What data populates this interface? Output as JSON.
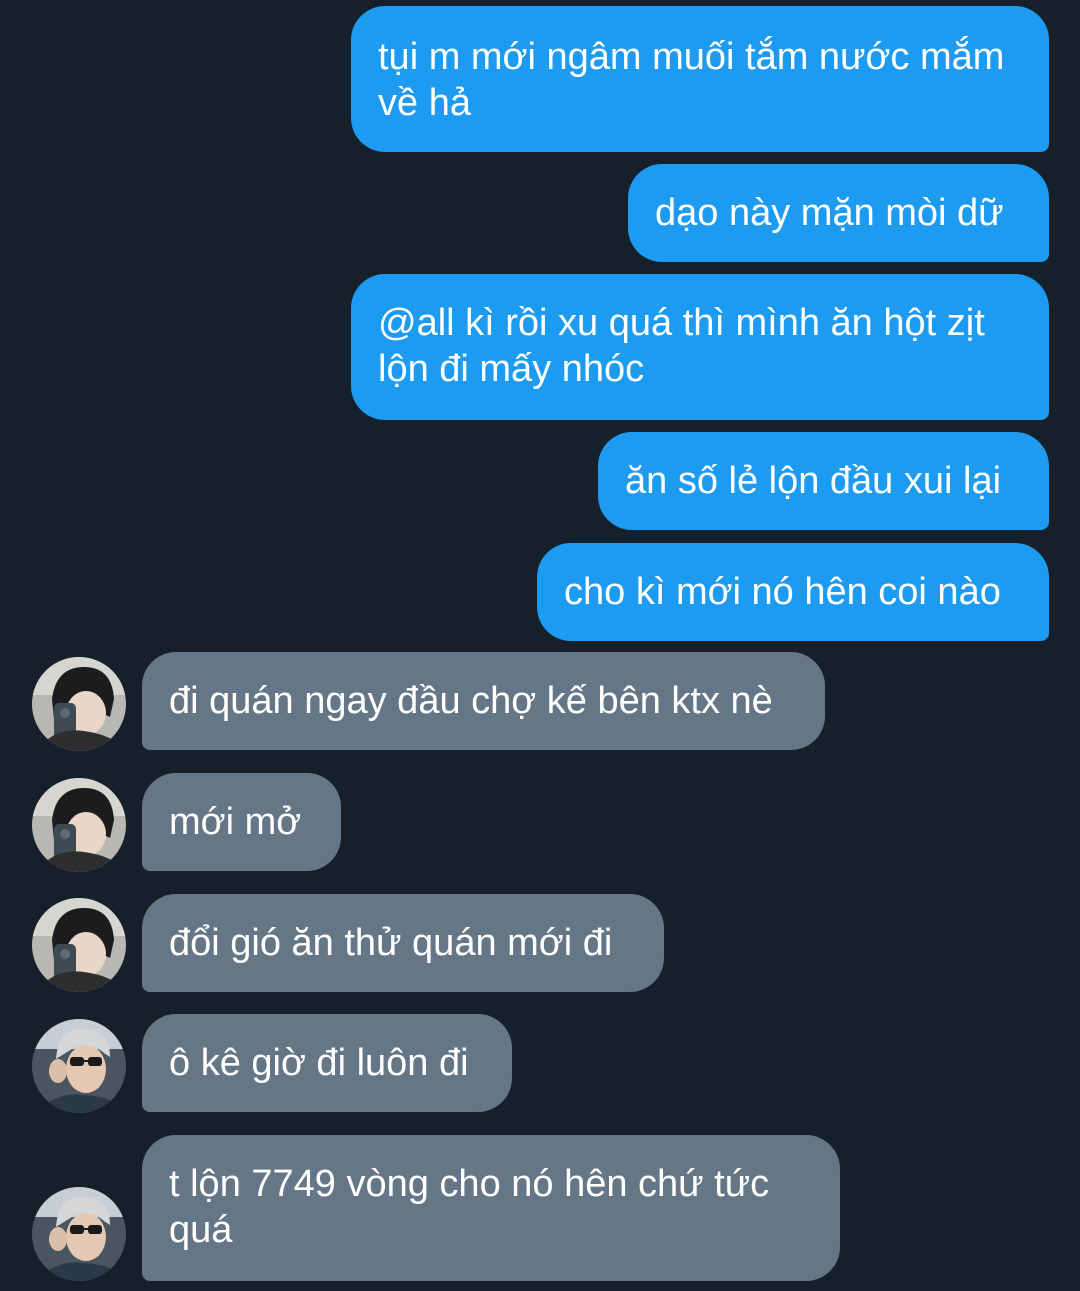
{
  "messages": [
    {
      "text": "tụi m mới ngâm muối tắm nước mắm về hả",
      "direction": "outgoing"
    },
    {
      "text": "dạo này mặn mòi dữ",
      "direction": "outgoing"
    },
    {
      "text": "@all kì rồi xu quá thì mình ăn hột zịt lộn đi mấy nhóc",
      "direction": "outgoing"
    },
    {
      "text": "ăn số lẻ lộn đầu xui lại",
      "direction": "outgoing"
    },
    {
      "text": "cho kì mới nó hên coi nào",
      "direction": "outgoing"
    },
    {
      "text": "đi quán ngay đầu chợ kế bên ktx nè",
      "direction": "incoming",
      "avatar": "avatar-user-a"
    },
    {
      "text": "mới mở",
      "direction": "incoming",
      "avatar": "avatar-user-a"
    },
    {
      "text": "đổi gió ăn thử quán mới đi",
      "direction": "incoming",
      "avatar": "avatar-user-a"
    },
    {
      "text": "ô kê giờ đi luôn đi",
      "direction": "incoming",
      "avatar": "avatar-user-b"
    },
    {
      "text": "t lộn 7749 vòng cho nó hên chứ tức quá",
      "direction": "incoming",
      "avatar": "avatar-user-b"
    }
  ],
  "colors": {
    "background": "#15202b",
    "outgoing_bubble": "#1d9bf0",
    "incoming_bubble": "#657786",
    "text": "#ffffff"
  }
}
